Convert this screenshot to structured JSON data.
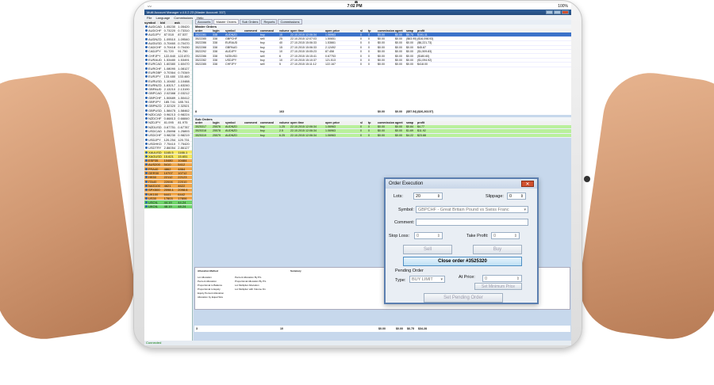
{
  "status": {
    "time": "7:02 PM",
    "battery": "100%",
    "connection": "Connected"
  },
  "window": {
    "title": "Multi Account Manager v.4.0.2.23 (Master Account: 337)"
  },
  "menu": [
    "File",
    "Language",
    "Commissions",
    "Help"
  ],
  "tabs": [
    "Accounts",
    "Master Orders",
    "Sub Orders",
    "Reports",
    "Commissions"
  ],
  "sidebar": {
    "headers": [
      "symbol",
      "bid",
      "ask"
    ],
    "rows": [
      [
        "AUDCAD",
        "1.05230",
        "1.05420",
        ""
      ],
      [
        "AUDCHF",
        "0.73220",
        "0.73310",
        ""
      ],
      [
        "AUDJPY",
        "87.518",
        "87.537",
        ""
      ],
      [
        "AUDNZD",
        "1.09510",
        "1.09540",
        ""
      ],
      [
        "AUDUSD",
        "0.70460",
        "0.70470",
        ""
      ],
      [
        "CADCHF",
        "0.70418",
        "0.70430",
        ""
      ],
      [
        "CADJPY",
        "91.720",
        "91.750",
        ""
      ],
      [
        "CHFJPY",
        "122.840",
        "122.870",
        ""
      ],
      [
        "EURAUD",
        "1.53480",
        "1.53491",
        ""
      ],
      [
        "EURCAD",
        "1.60380",
        "1.60470",
        ""
      ],
      [
        "EURCHF",
        "1.08090",
        "1.08127",
        ""
      ],
      [
        "EURGBP",
        "0.70364",
        "0.70349",
        ""
      ],
      [
        "EURJPY",
        "133.480",
        "133.460",
        ""
      ],
      [
        "EURUSD",
        "1.10482",
        "1.10488",
        ""
      ],
      [
        "EURNZD",
        "1.63217",
        "1.63240",
        ""
      ],
      [
        "GBPAUD",
        "2.13210",
        "2.13190",
        ""
      ],
      [
        "GBPCAD",
        "2.02388",
        "2.03212",
        ""
      ],
      [
        "GBPCHF",
        "1.50689",
        "1.50412",
        ""
      ],
      [
        "GBPJPY",
        "185.741",
        "185.741",
        ""
      ],
      [
        "GBPNZD",
        "2.32320",
        "2.32521",
        ""
      ],
      [
        "GBPUSD",
        "1.58475",
        "1.58462",
        ""
      ],
      [
        "NZDCAD",
        "0.96213",
        "0.98224",
        ""
      ],
      [
        "NZDCHF",
        "0.66813",
        "0.66840",
        ""
      ],
      [
        "NZDJPY",
        "81.095",
        "81.975",
        ""
      ],
      [
        "NZDUSD",
        "0.67751",
        "0.67787",
        ""
      ],
      [
        "USDCAD",
        "1.25898",
        "1.25893",
        ""
      ],
      [
        "USDCHF",
        "0.98230",
        "0.98219",
        ""
      ],
      [
        "USDJPY",
        "120.254",
        "120.731",
        ""
      ],
      [
        "USDHKD",
        "7.75410",
        "7.75420",
        ""
      ],
      [
        "USDTRY",
        "2.86054",
        "2.86127",
        ""
      ],
      [
        "XAUUSD",
        "1165.5",
        "1166.1",
        "yel"
      ],
      [
        "XAGUSD",
        "15.621",
        "15.651",
        "yel"
      ],
      [
        "ESP35",
        "10480",
        "10484",
        "org"
      ],
      [
        "AUS200",
        "5410",
        "5412",
        "org"
      ],
      [
        "FRA40",
        "4862",
        "4864",
        "org"
      ],
      [
        "GER30",
        "10707",
        "10712",
        "org"
      ],
      [
        "HK50",
        "22112",
        "22123",
        "org"
      ],
      [
        "ITA40",
        "22006",
        "22010",
        "org"
      ],
      [
        "NAS100",
        "4621",
        "4622",
        "org"
      ],
      [
        "SPX500",
        "2098.1",
        "2098.6",
        "org"
      ],
      [
        "UK100",
        "6441",
        "6442",
        "org"
      ],
      [
        "US30",
        "17803",
        "17806",
        "org"
      ],
      [
        "USOIL",
        "44.19",
        "44.24",
        "grn"
      ],
      [
        "UKOIL",
        "48.19",
        "48.24",
        "grn"
      ]
    ]
  },
  "master": {
    "title": "Master Orders",
    "headers": [
      "order",
      "login",
      "symbol",
      "comment",
      "command",
      "volume",
      "open time",
      "open price",
      "sl",
      "tp",
      "commission",
      "agent",
      "swap",
      "profit"
    ],
    "rows": [
      [
        "3522281",
        "338",
        "AUDNZD",
        "",
        "buy",
        "10",
        "22.10.2015 12:06:34",
        "1.06963",
        "0",
        "0",
        "$0.00",
        "$0.00",
        "$6.75",
        "$191.11"
      ],
      [
        "3522285",
        "338",
        "GBPCHF",
        "",
        "sell",
        "25",
        "22.10.2015 12:07:03",
        "1.50651",
        "0",
        "0",
        "$0.00",
        "$0.00",
        "($63.95)",
        "($16,098.93)"
      ],
      [
        "3522286",
        "338",
        "EURAUD",
        "",
        "buy",
        "40",
        "27.10.2015 15:06:33",
        "1.53661",
        "0",
        "0",
        "$0.00",
        "$0.00",
        "$0.00",
        "($6,221.73)"
      ],
      [
        "3522288",
        "338",
        "GBPAUD",
        "",
        "buy",
        "15",
        "27.10.2015 15:06:33",
        "2.12492",
        "0",
        "0",
        "$0.00",
        "$0.00",
        "$0.00",
        "$45.87"
      ],
      [
        "3522292",
        "338",
        "AUDJPY",
        "",
        "buy",
        "10",
        "27.10.2015 15:05:23",
        "87.458",
        "0",
        "0",
        "$0.00",
        "$0.00",
        "$0.00",
        "($1,509.83)"
      ],
      [
        "3522286",
        "338",
        "NZDUSD",
        "",
        "sell",
        "6",
        "27.10.2015 15:15:41",
        "0.67753",
        "0",
        "0",
        "$0.00",
        "$0.00",
        "$0.00",
        "($180.60)"
      ],
      [
        "3522282",
        "338",
        "USDJPY",
        "",
        "buy",
        "10",
        "27.10.2015 15:10:37",
        "121.513",
        "0",
        "0",
        "$0.00",
        "$0.00",
        "$0.00",
        "($1,094.92)"
      ],
      [
        "3522285",
        "338",
        "CHFJPY",
        "",
        "sell",
        "5",
        "27.10.2015 15:11:12",
        "122.167",
        "0",
        "0",
        "$0.00",
        "$0.00",
        "$0.00",
        "$418.00"
      ]
    ],
    "totals": [
      "8",
      "",
      "",
      "",
      "",
      "163",
      "",
      "",
      "",
      "",
      "$0.00",
      "$0.00",
      "($57.54)",
      "($26,263.57)"
    ]
  },
  "sub": {
    "title": "Sub Orders",
    "headers": [
      "order",
      "login",
      "symbol",
      "comment",
      "command",
      "volume",
      "open time",
      "open price",
      "sl",
      "tp",
      "commission",
      "agent",
      "swap",
      "profit"
    ],
    "rows": [
      [
        "3525317",
        "25576",
        "AUDNZD",
        "",
        "buy",
        "1.25",
        "22.10.2015 12:06:34",
        "1.06963",
        "0",
        "0",
        "$0.00",
        "$0.00",
        "$0.84",
        "$4.77"
      ],
      [
        "3525318",
        "25578",
        "AUDNZD",
        "",
        "buy",
        "2.5",
        "22.10.2015 12:06:34",
        "1.06963",
        "0",
        "0",
        "$0.00",
        "$0.00",
        "$1.69",
        "$11.92"
      ],
      [
        "3525319",
        "25579",
        "AUDNZD",
        "",
        "buy",
        "6.25",
        "22.10.2015 12:06:34",
        "1.06963",
        "0",
        "0",
        "$0.00",
        "$0.00",
        "$4.22",
        "$23.88"
      ]
    ]
  },
  "footer": {
    "totals": [
      "3",
      "",
      "",
      "",
      "",
      "10",
      "",
      "",
      "",
      "",
      "$0.00",
      "$0.00",
      "$6.75",
      "$34.28"
    ]
  },
  "alloc": {
    "title": "Allocation Method",
    "summary": "Summary",
    "options": [
      "Lot Allocation",
      "Percent Allocation",
      "Proportional to Balance",
      "Proportional to Equity",
      "Equity Percent Allocation",
      "Allocation by Equal Size",
      "Percent Allocation By P/L",
      "Proportional Allocation By P/L",
      "Lot Multiplier Allocation",
      "Lot Multiplier with Volume Fix"
    ]
  },
  "dialog": {
    "title": "Order Execution",
    "lots_label": "Lots:",
    "lots_value": "20",
    "slippage_label": "Slippage:",
    "slippage_value": "0",
    "symbol_label": "Symbol:",
    "symbol_value": "GBPCHF - Great Britain Pound vs Swiss Franc",
    "comment_label": "Comment:",
    "stoploss_label": "Stop Loss:",
    "stoploss_value": "0",
    "takeprofit_label": "Take Profit:",
    "takeprofit_value": "0",
    "sell": "Sell",
    "buy": "Buy",
    "close_order": "Close order #3525320",
    "pending_label": "Pending Order",
    "type_label": "Type:",
    "type_value": "BUY LIMIT",
    "atprice_label": "At Price:",
    "atprice_value": "0",
    "set_min": "Set Minimum Price",
    "set_pending": "Set Pending Order"
  }
}
